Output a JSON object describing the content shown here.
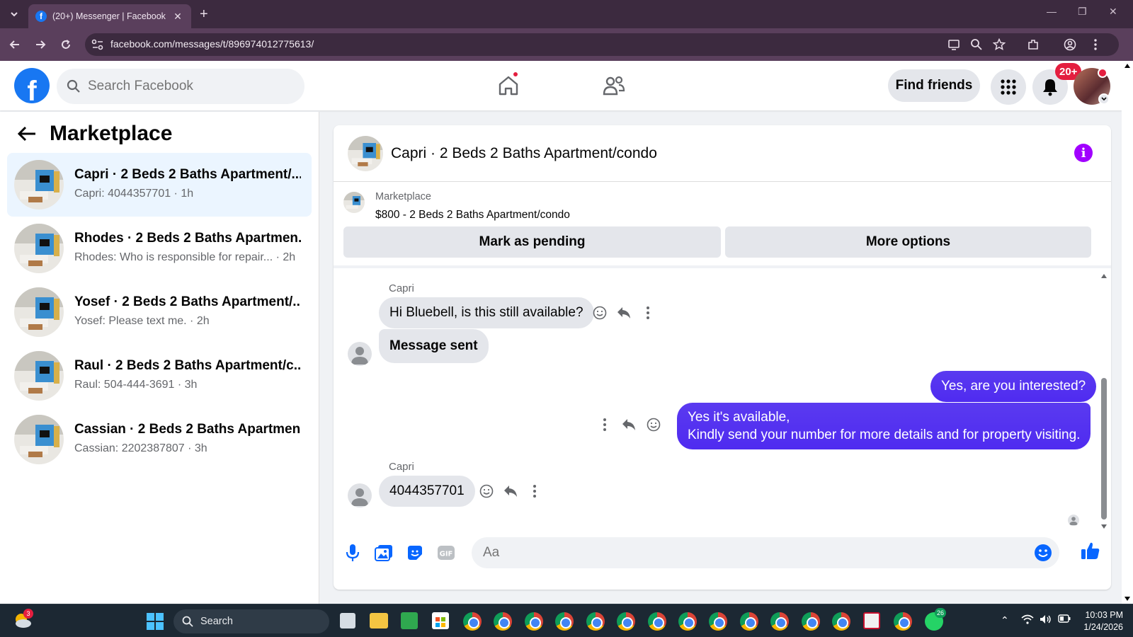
{
  "browser": {
    "tab_title": "(20+) Messenger | Facebook",
    "url": "facebook.com/messages/t/896974012775613/"
  },
  "fb_nav": {
    "search_placeholder": "Search Facebook",
    "find_friends": "Find friends",
    "notification_badge": "20+"
  },
  "sidebar": {
    "title": "Marketplace",
    "conversations": [
      {
        "name": "Capri · 2 Beds 2 Baths Apartment/...",
        "preview": "Capri: 4044357701 · 1h",
        "active": true
      },
      {
        "name": "Rhodes · 2 Beds 2 Baths Apartmen...",
        "preview": "Rhodes: Who is responsible for repair...  · 2h",
        "active": false
      },
      {
        "name": "Yosef · 2 Beds 2 Baths Apartment/...",
        "preview": "Yosef: Please text me. · 2h",
        "active": false
      },
      {
        "name": "Raul · 2 Beds 2 Baths Apartment/c...",
        "preview": "Raul: 504-444-3691 · 3h",
        "active": false
      },
      {
        "name": "Cassian · 2 Beds 2 Baths Apartmen...",
        "preview": "Cassian: 2202387807 · 3h",
        "active": false
      }
    ]
  },
  "chat": {
    "title": "Capri · 2 Beds 2 Baths Apartment/condo",
    "marketplace_label": "Marketplace",
    "listing": "$800 - 2 Beds 2 Baths Apartment/condo",
    "mark_pending": "Mark as pending",
    "more_options": "More options",
    "messages": [
      {
        "sender": "Capri",
        "text": "Hi Bluebell, is this still available?",
        "direction": "in"
      },
      {
        "text": "Message sent",
        "direction": "in"
      },
      {
        "text": "Yes, are you interested?",
        "direction": "out"
      },
      {
        "text_line1": "Yes it's available,",
        "text_line2": "Kindly send your number for more details and for property visiting.",
        "direction": "out"
      },
      {
        "sender": "Capri",
        "text": "4044357701",
        "direction": "in"
      }
    ],
    "composer_placeholder": "Aa"
  },
  "taskbar": {
    "search_label": "Search",
    "time": "10:03 PM",
    "date": "1/24/2026",
    "weather_badge": "3",
    "whatsapp_badge": "26"
  },
  "colors": {
    "fb_blue": "#1877f2",
    "outgoing_bubble": "#4f2bf0",
    "badge_red": "#e41e3f",
    "browser_frame": "#3c2a3f"
  }
}
